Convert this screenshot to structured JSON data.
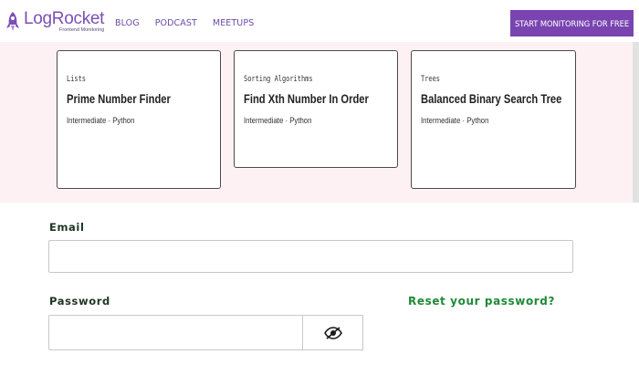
{
  "header": {
    "logo_text": "LogRocket",
    "logo_subtext": "Frontend Monitoring",
    "nav": [
      "BLOG",
      "PODCAST",
      "MEETUPS"
    ],
    "cta_label": "START MONITORING FOR FREE"
  },
  "cards": [
    {
      "category": "Lists",
      "title": "Prime Number Finder",
      "meta": "Intermediate · Python"
    },
    {
      "category": "Sorting Algorithms",
      "title": "Find Xth Number In Order",
      "meta": "Intermediate · Python"
    },
    {
      "category": "Trees",
      "title": "Balanced Binary Search Tree",
      "meta": "Intermediate · Python"
    }
  ],
  "form": {
    "email_label": "Email",
    "email_value": "",
    "password_label": "Password",
    "password_value": "",
    "reset_link": "Reset your password?",
    "visibility_icon": "eye-slash-icon"
  },
  "colors": {
    "brand": "#7a44b0",
    "band": "#fdf1f4",
    "link_green": "#1f8a36",
    "label_dark": "#1f3324"
  }
}
